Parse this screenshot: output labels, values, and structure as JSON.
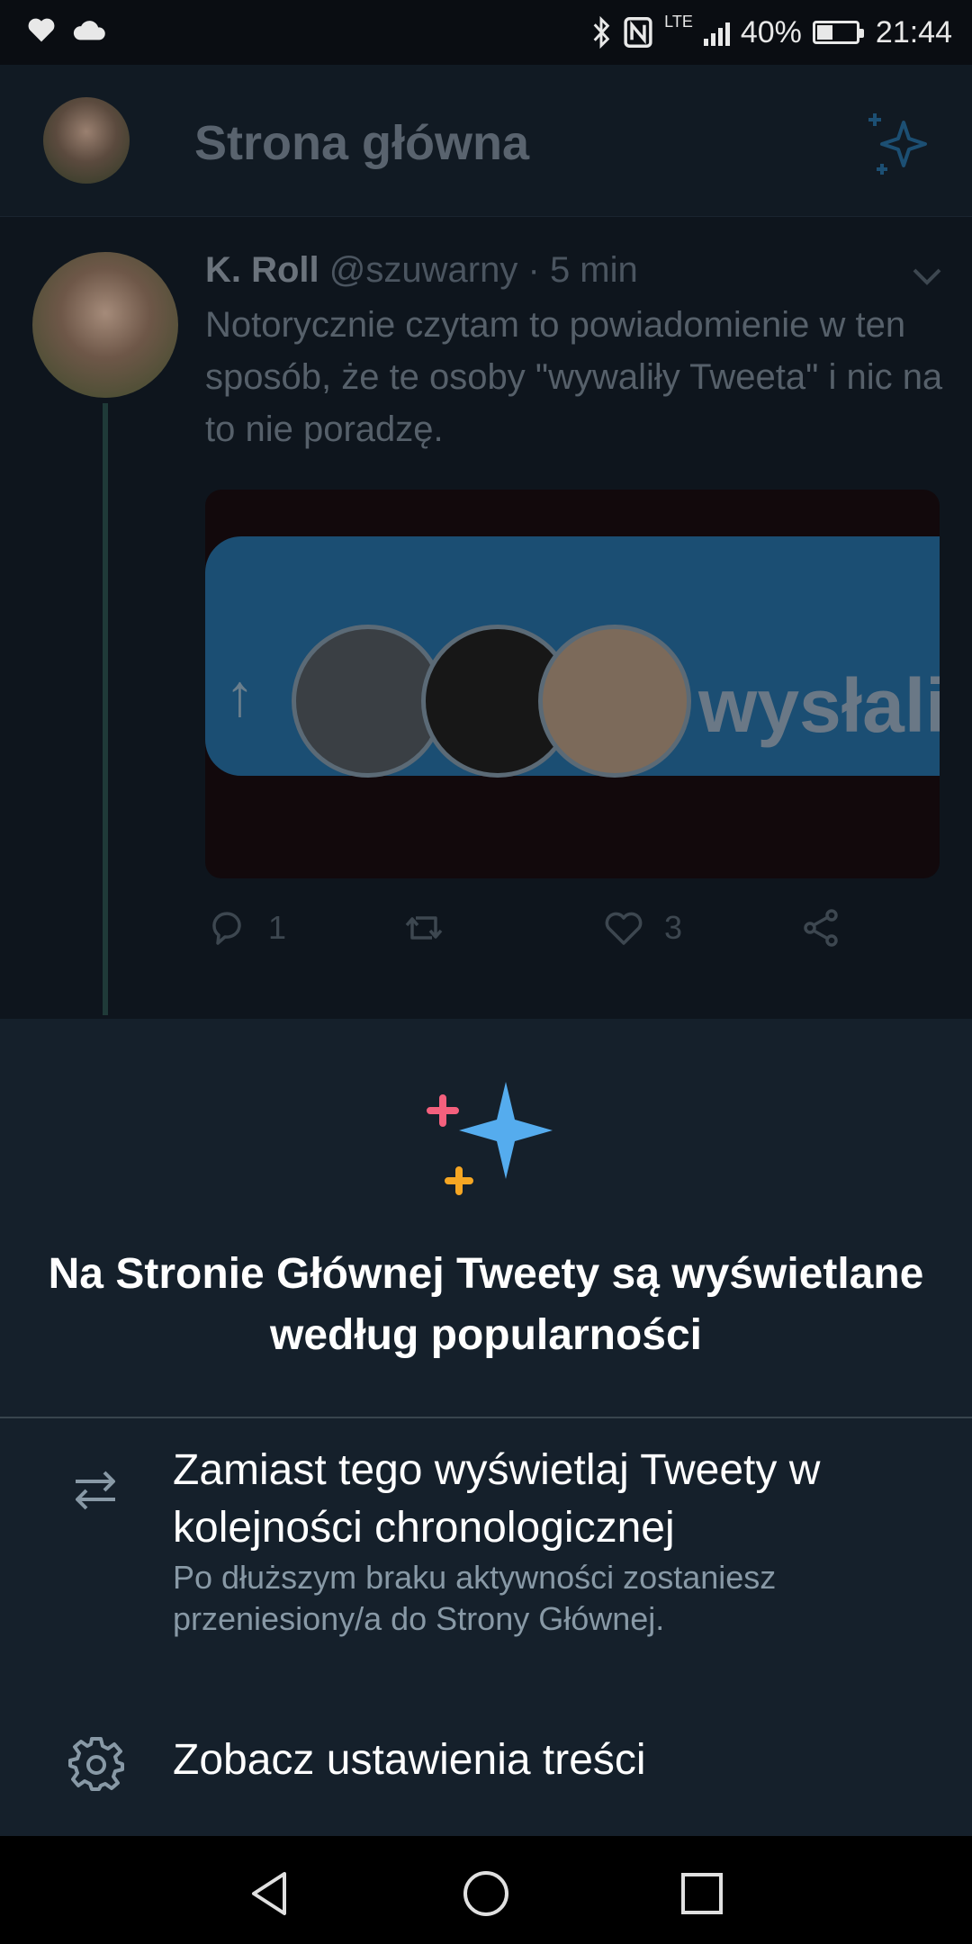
{
  "status_bar": {
    "network": "LTE",
    "battery_percent": 40,
    "battery_text": "40%",
    "time": "21:44"
  },
  "header": {
    "title": "Strona główna",
    "spark_icon": "sparkle-icon"
  },
  "tweet": {
    "author_name": "K. Roll",
    "handle": "@szuwarny",
    "separator": "·",
    "time": "5 min",
    "text": "Notorycznie czytam to powiadomienie w ten sposób, że te osoby \"wywaliły Tweeta\" i nic na to nie poradzę.",
    "media_word": "wysłali",
    "reply_count": "1",
    "retweet_count": "",
    "like_count": "3"
  },
  "sheet": {
    "title": "Na Stronie Głównej Tweety są wyświetlane według popularności",
    "option_chronological": {
      "title": "Zamiast tego wyświetlaj Tweety w kolejności chronologicznej",
      "subtitle": "Po dłuższym braku aktywności zostaniesz przeniesiony/a do Strony Głównej."
    },
    "option_settings": {
      "label": "Zobacz ustawienia treści"
    },
    "colors": {
      "spark_blue": "#55acee",
      "spark_pink": "#f4607d",
      "spark_orange": "#f5a623"
    }
  }
}
